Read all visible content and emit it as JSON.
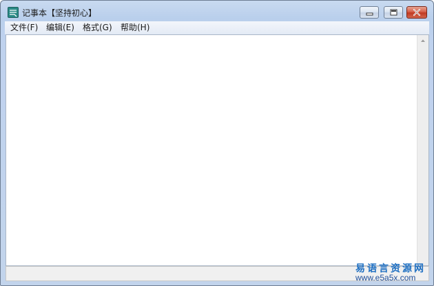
{
  "window": {
    "title": "记事本【坚持初心】"
  },
  "icons": {
    "app": "notepad-app-icon",
    "minimize": "minimize-icon",
    "maximize": "maximize-icon",
    "close": "close-icon",
    "scroll_up": "scroll-up-arrow-icon"
  },
  "menu": {
    "items": [
      {
        "label": "文件(F)"
      },
      {
        "label": "编辑(E)"
      },
      {
        "label": "格式(G)"
      },
      {
        "label": "帮助(H)"
      }
    ]
  },
  "editor": {
    "content": ""
  },
  "watermark": {
    "name": "易语言资源网",
    "site": "www.e5a5x.com"
  },
  "colors": {
    "close_button": "#c13a22",
    "watermark": "#1e6fc2"
  }
}
